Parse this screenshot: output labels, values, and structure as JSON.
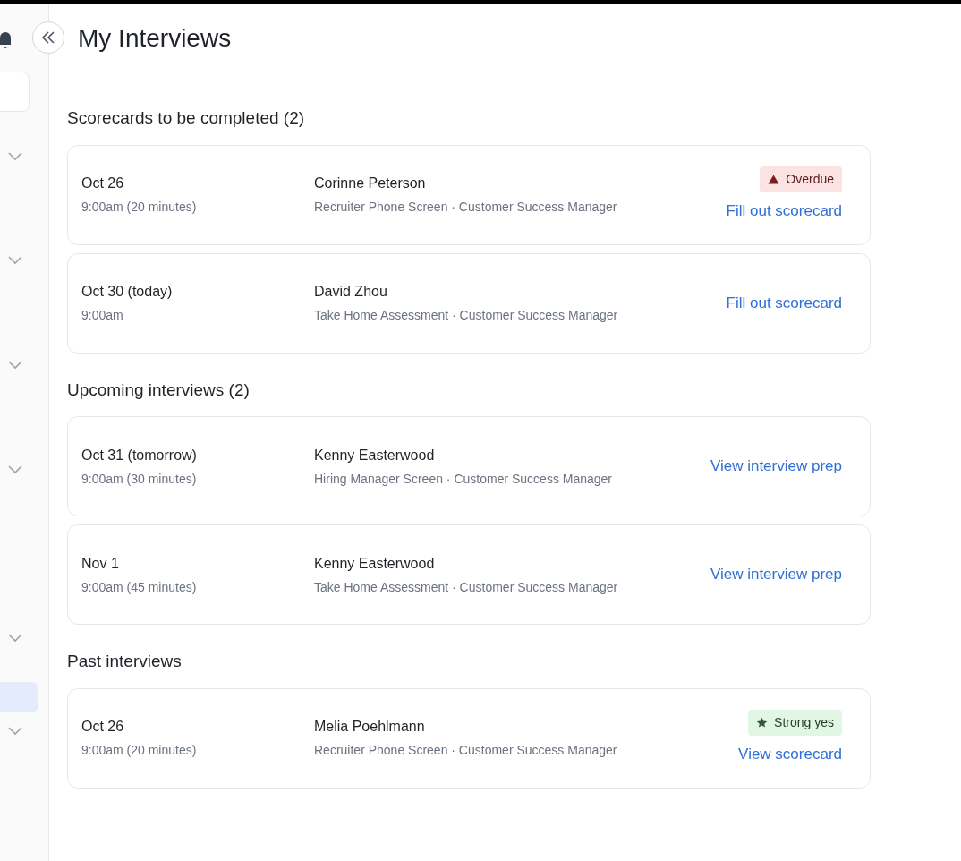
{
  "sidebar": {
    "items": [
      {
        "kind": "group",
        "selected": false
      },
      {
        "kind": "group",
        "selected": false
      },
      {
        "kind": "group",
        "selected": false
      },
      {
        "kind": "group",
        "selected": false
      },
      {
        "kind": "group",
        "selected": false
      },
      {
        "kind": "link",
        "selected": true
      },
      {
        "kind": "group",
        "selected": false
      }
    ]
  },
  "header": {
    "title": "My Interviews"
  },
  "sections": [
    {
      "title": "Scorecards to be completed (2)",
      "interviews": [
        {
          "date": "Oct 26",
          "time": "9:00am (20 minutes)",
          "candidate": "Corinne Peterson",
          "details": "Recruiter Phone Screen · Customer Success Manager",
          "badge": {
            "kind": "overdue",
            "label": "Overdue"
          },
          "action": "Fill out scorecard"
        },
        {
          "date": "Oct 30 (today)",
          "time": "9:00am",
          "candidate": "David Zhou",
          "details": "Take Home Assessment · Customer Success Manager",
          "action": "Fill out scorecard"
        }
      ]
    },
    {
      "title": "Upcoming interviews (2)",
      "interviews": [
        {
          "date": "Oct 31 (tomorrow)",
          "time": "9:00am (30 minutes)",
          "candidate": "Kenny Easterwood",
          "details": "Hiring Manager Screen · Customer Success Manager",
          "action": "View interview prep"
        },
        {
          "date": "Nov 1",
          "time": "9:00am (45 minutes)",
          "candidate": "Kenny Easterwood",
          "details": "Take Home Assessment · Customer Success Manager",
          "action": "View interview prep"
        }
      ]
    },
    {
      "title": "Past interviews",
      "interviews": [
        {
          "date": "Oct 26",
          "time": "9:00am (20 minutes)",
          "candidate": "Melia Poehlmann",
          "details": "Recruiter Phone Screen · Customer Success Manager",
          "badge": {
            "kind": "positive",
            "label": "Strong yes"
          },
          "action": "View scorecard"
        }
      ]
    }
  ]
}
